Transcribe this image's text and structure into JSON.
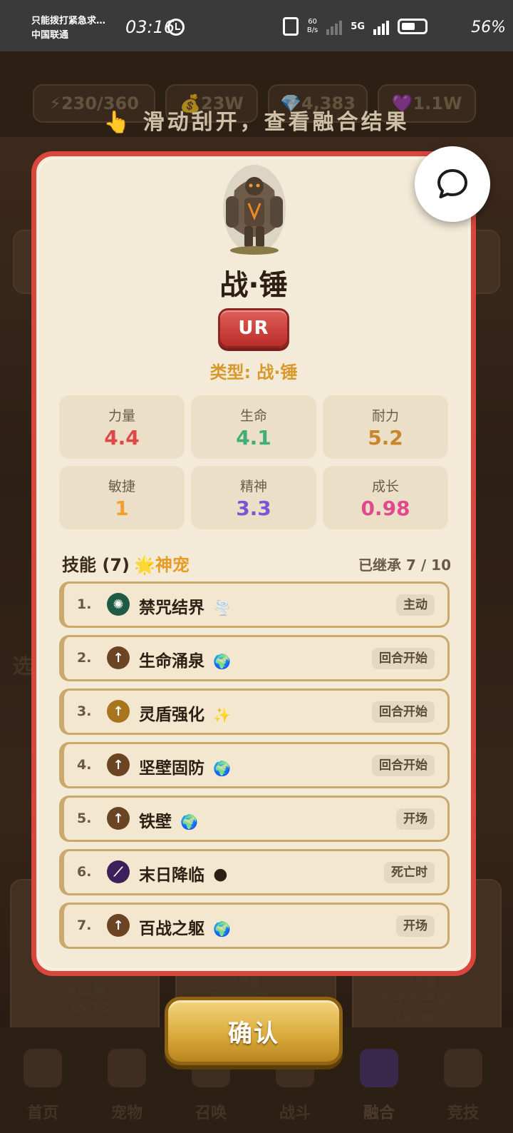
{
  "status_bar": {
    "notification": "只能拨打紧急求…",
    "carrier": "中国联通",
    "time": "03:16",
    "net_speed_top": "60",
    "net_speed_bottom": "B/s",
    "network_5g": "5G",
    "battery": "56%"
  },
  "background": {
    "resources": [
      "⚡230/360",
      "💰23W",
      "💎4,383",
      "💜1.1W"
    ],
    "faint_texts": [
      "选",
      "★主角",
      "Lv.73",
      "有魂器",
      "别着狗子",
      "有装备",
      "狗子没主动",
      "Lv.98"
    ]
  },
  "hint": {
    "icon": "👆",
    "text": "滑动刮开，查看融合结果"
  },
  "pet": {
    "name": "战·锤",
    "rarity": "UR",
    "type_label": "类型: 战·锤"
  },
  "stats": [
    {
      "label": "力量",
      "value": "4.4",
      "color": "#e04848"
    },
    {
      "label": "生命",
      "value": "4.1",
      "color": "#3fae78"
    },
    {
      "label": "耐力",
      "value": "5.2",
      "color": "#c8862a"
    },
    {
      "label": "敏捷",
      "value": "1",
      "color": "#f0a030"
    },
    {
      "label": "精神",
      "value": "3.3",
      "color": "#7b55d6"
    },
    {
      "label": "成长",
      "value": "0.98",
      "color": "#e2488e"
    }
  ],
  "skills_header": {
    "title": "技能 (7)",
    "god_badge": "🌟神宠",
    "inherited": "已继承 7 / 10"
  },
  "skills": [
    {
      "num": "1.",
      "icon": "✺",
      "icon_bg": "#1f5a45",
      "name": "禁咒结界",
      "emoji": "🌪️",
      "tag": "主动"
    },
    {
      "num": "2.",
      "icon": "↑",
      "icon_bg": "#6b4424",
      "name": "生命涌泉",
      "emoji": "🌍",
      "tag": "回合开始"
    },
    {
      "num": "3.",
      "icon": "↑",
      "icon_bg": "#a8741e",
      "name": "灵盾强化",
      "emoji": "✨",
      "tag": "回合开始"
    },
    {
      "num": "4.",
      "icon": "↑",
      "icon_bg": "#6b4424",
      "name": "坚壁固防",
      "emoji": "🌍",
      "tag": "回合开始"
    },
    {
      "num": "5.",
      "icon": "↑",
      "icon_bg": "#6b4424",
      "name": "铁壁",
      "emoji": "🌍",
      "tag": "开场"
    },
    {
      "num": "6.",
      "icon": "⟋",
      "icon_bg": "#3d1f5c",
      "name": "末日降临",
      "emoji": "🌑",
      "tag": "死亡时"
    },
    {
      "num": "7.",
      "icon": "↑",
      "icon_bg": "#6b4424",
      "name": "百战之躯",
      "emoji": "🌍",
      "tag": "开场"
    }
  ],
  "confirm_label": "确认",
  "nav": [
    {
      "label": "首页",
      "icon": "castle-icon"
    },
    {
      "label": "宠物",
      "icon": "paw-icon"
    },
    {
      "label": "召唤",
      "icon": "summon-icon"
    },
    {
      "label": "战斗",
      "icon": "swords-icon"
    },
    {
      "label": "融合",
      "icon": "dragon-icon"
    },
    {
      "label": "竞技",
      "icon": "trophy-icon"
    }
  ]
}
